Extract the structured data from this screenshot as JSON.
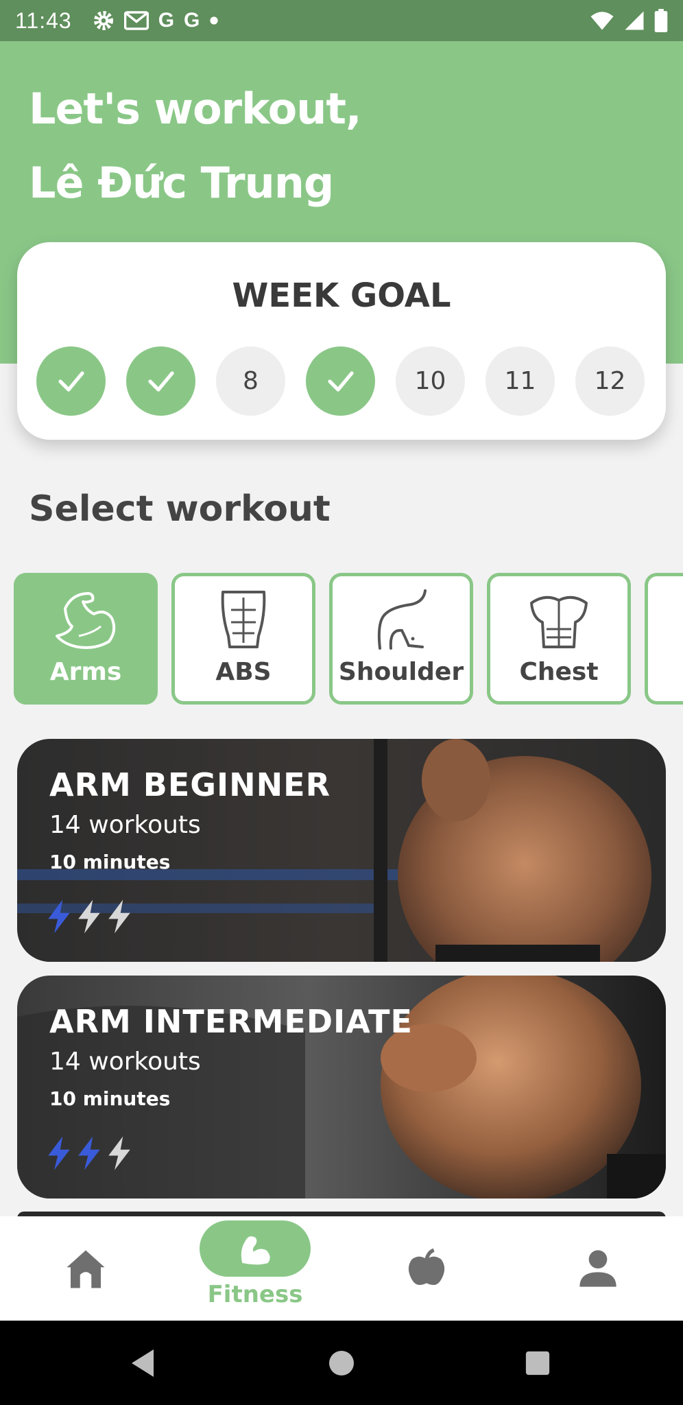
{
  "status_bar": {
    "time": "11:43",
    "left_icons": [
      "gear-icon",
      "gmail-icon",
      "G",
      "G",
      "dot-icon"
    ],
    "right_icons": [
      "wifi-icon",
      "signal-icon",
      "battery-icon"
    ]
  },
  "header": {
    "greeting_line1": "Let's workout,",
    "greeting_line2": "Lê Đức Trung"
  },
  "week_goal": {
    "title": "WEEK GOAL",
    "days": [
      {
        "label": "",
        "done": true
      },
      {
        "label": "",
        "done": true
      },
      {
        "label": "8",
        "done": false
      },
      {
        "label": "",
        "done": true
      },
      {
        "label": "10",
        "done": false
      },
      {
        "label": "11",
        "done": false
      },
      {
        "label": "12",
        "done": false
      }
    ]
  },
  "select_workout": {
    "title": "Select workout",
    "categories": [
      {
        "label": "Arms",
        "icon": "biceps-icon",
        "active": true
      },
      {
        "label": "ABS",
        "icon": "abs-icon",
        "active": false
      },
      {
        "label": "Shoulder",
        "icon": "shoulder-icon",
        "active": false
      },
      {
        "label": "Chest",
        "icon": "chest-icon",
        "active": false
      }
    ]
  },
  "programs": [
    {
      "title": "ARM BEGINNER",
      "workouts": "14 workouts",
      "duration": "10 minutes",
      "level": 1,
      "max_level": 3
    },
    {
      "title": "ARM INTERMEDIATE",
      "workouts": "14 workouts",
      "duration": "10 minutes",
      "level": 2,
      "max_level": 3
    }
  ],
  "bottom_nav": {
    "items": [
      {
        "icon": "home-icon",
        "label": ""
      },
      {
        "icon": "fitness-icon",
        "label": "Fitness",
        "active": true
      },
      {
        "icon": "apple-icon",
        "label": ""
      },
      {
        "icon": "profile-icon",
        "label": ""
      }
    ]
  },
  "colors": {
    "accent": "#8ac787",
    "status_bar": "#5f8f5c",
    "bolt_active": "#3a5bd9",
    "bolt_inactive": "#d8d8d8"
  }
}
